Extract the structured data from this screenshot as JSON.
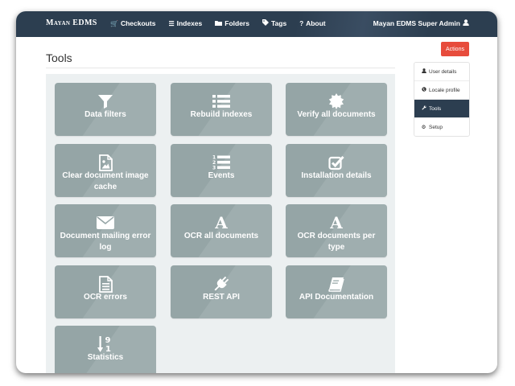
{
  "navbar": {
    "brand": "Mayan EDMS",
    "items": [
      {
        "label": "Checkouts",
        "icon": "cart-icon"
      },
      {
        "label": "Indexes",
        "icon": "list-icon"
      },
      {
        "label": "Folders",
        "icon": "folder-icon"
      },
      {
        "label": "Tags",
        "icon": "tag-icon"
      },
      {
        "label": "About",
        "icon": "question-icon"
      }
    ],
    "user": {
      "label": "Mayan EDMS Super Admin",
      "icon": "user-icon"
    }
  },
  "page": {
    "title": "Tools"
  },
  "tools": [
    {
      "label": "Data filters",
      "icon": "filter-icon"
    },
    {
      "label": "Rebuild indexes",
      "icon": "list-icon"
    },
    {
      "label": "Verify all documents",
      "icon": "certificate-icon"
    },
    {
      "label": "Clear document image cache",
      "icon": "image-file-icon"
    },
    {
      "label": "Events",
      "icon": "ordered-list-icon"
    },
    {
      "label": "Installation details",
      "icon": "check-square-icon"
    },
    {
      "label": "Document mailing error log",
      "icon": "envelope-icon"
    },
    {
      "label": "OCR all documents",
      "icon": "letter-a-icon"
    },
    {
      "label": "OCR documents per type",
      "icon": "letter-a-icon"
    },
    {
      "label": "OCR errors",
      "icon": "text-file-icon"
    },
    {
      "label": "REST API",
      "icon": "plug-icon"
    },
    {
      "label": "API Documentation",
      "icon": "book-icon"
    },
    {
      "label": "Statistics",
      "icon": "sort-numeric-icon"
    }
  ],
  "sidebar": {
    "actions_label": "Actions",
    "items": [
      {
        "label": "User details",
        "icon": "user-icon",
        "active": false
      },
      {
        "label": "Locale profile",
        "icon": "globe-icon",
        "active": false
      },
      {
        "label": "Tools",
        "icon": "wrench-icon",
        "active": true
      },
      {
        "label": "Setup",
        "icon": "gear-icon",
        "active": false
      }
    ]
  },
  "colors": {
    "navbar": "#2c3e50",
    "tile": "#95a5a6",
    "tools_background": "#ecf0f1",
    "actions": "#e74c3c",
    "active_item": "#2c3e50"
  }
}
